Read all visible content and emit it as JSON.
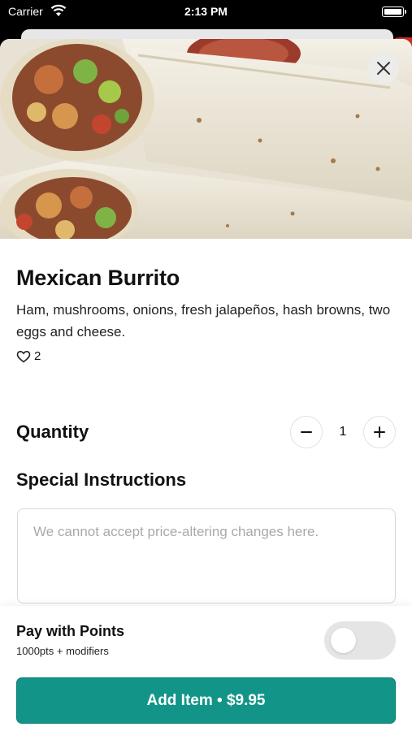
{
  "status_bar": {
    "carrier": "Carrier",
    "time": "2:13 PM"
  },
  "item": {
    "title": "Mexican Burrito",
    "description": "Ham, mushrooms, onions, fresh jalapeños, hash browns, two eggs and cheese.",
    "likes": "2"
  },
  "quantity": {
    "label": "Quantity",
    "value": "1"
  },
  "special_instructions": {
    "label": "Special Instructions",
    "placeholder": "We cannot accept price-altering changes here."
  },
  "points": {
    "title": "Pay with Points",
    "subtitle": "1000pts + modifiers",
    "enabled": false
  },
  "add_button": {
    "label": "Add Item • $9.95"
  },
  "colors": {
    "accent": "#129588",
    "toggle_off": "#e5e5e5"
  }
}
